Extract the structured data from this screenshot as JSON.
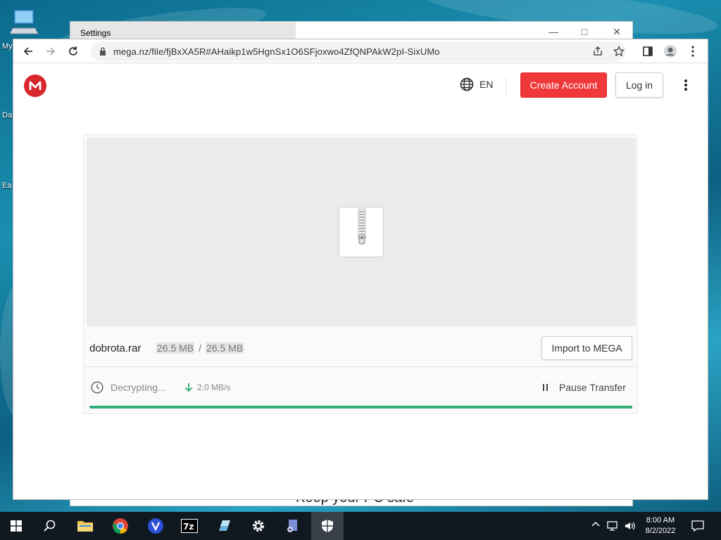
{
  "desktop": {
    "icons": [
      {
        "label": "My"
      },
      {
        "label": "Da"
      },
      {
        "label": "Ea"
      }
    ]
  },
  "settings_window": {
    "title": "Settings",
    "bottom_text": "Keep your PC safe"
  },
  "browser": {
    "url": "mega.nz/file/fjBxXA5R#AHaikp1w5HgnSx1O6SFjoxwo4ZfQNPAkW2pI-SixUMo"
  },
  "mega": {
    "language": "EN",
    "create_account_label": "Create Account",
    "login_label": "Log in",
    "file_name": "dobrota.rar",
    "downloaded": "26.5 MB",
    "size_separator": "/",
    "total_size": "26.5 MB",
    "import_label": "Import to MEGA",
    "status": "Decrypting...",
    "speed": "2.0 MB/s",
    "pause_label": "Pause Transfer",
    "progress": 1.0,
    "accent": "#f0373a",
    "progress_color": "#2fae7a"
  },
  "taskbar": {
    "time": "8:00 AM",
    "date": "8/2/2022",
    "apps": [
      "start",
      "search",
      "file-explorer",
      "chrome",
      "vpn-app",
      "7zip",
      "app-icon",
      "settings",
      "media-app",
      "security"
    ]
  }
}
